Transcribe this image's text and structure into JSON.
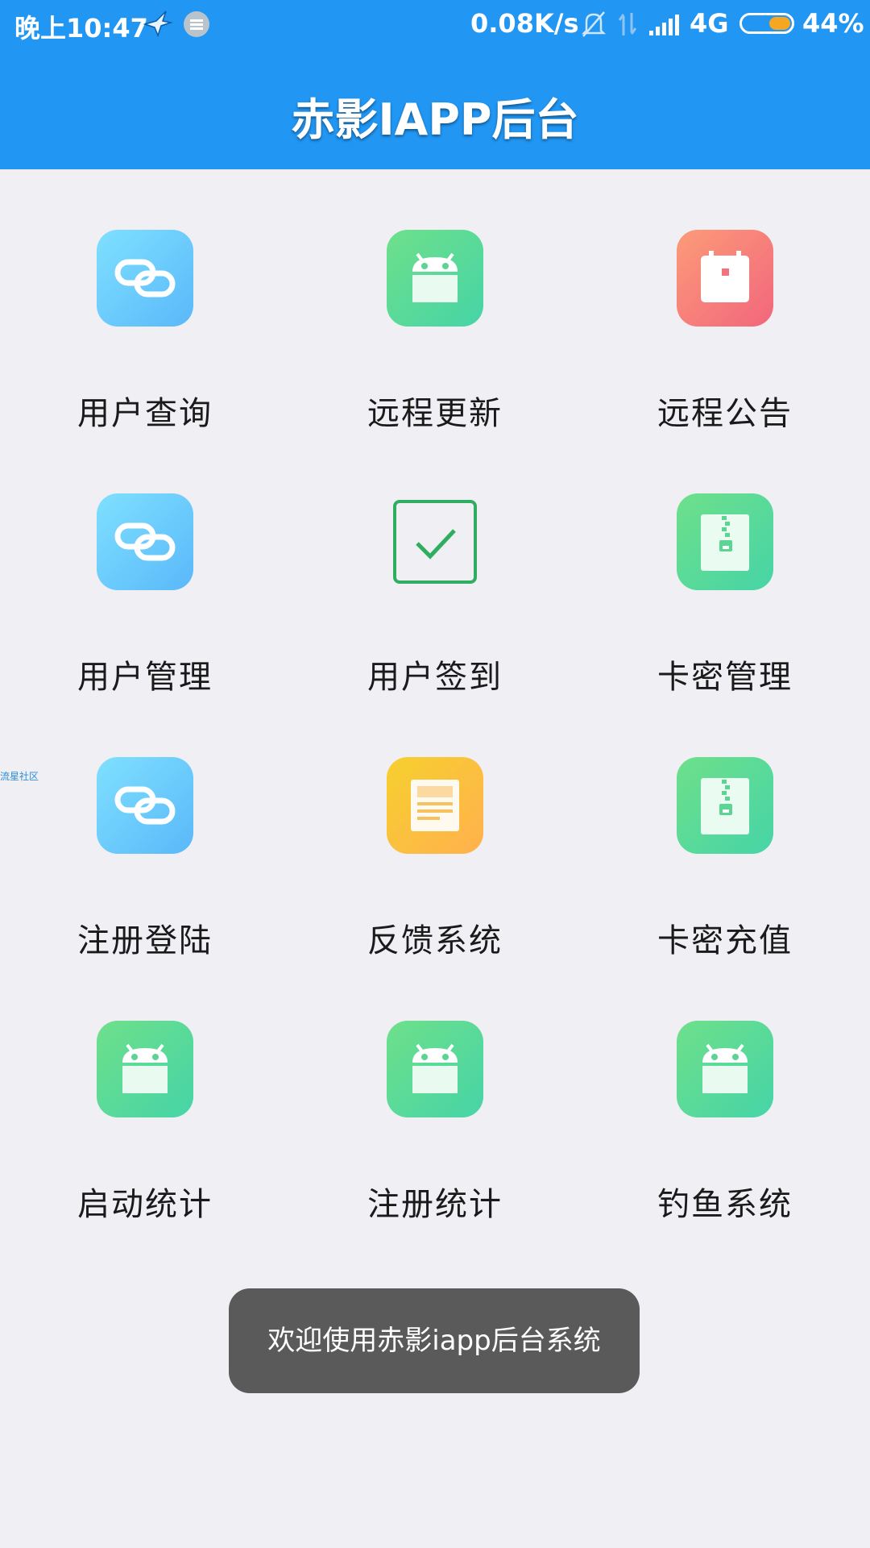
{
  "status_bar": {
    "time": "晚上10:47",
    "net_speed": "0.08K/s",
    "network": "4G",
    "battery_percent": "44%",
    "battery_level": 0.44,
    "icons": [
      "bird-icon",
      "message-icon",
      "bell-muted-icon",
      "data-arrows-icon",
      "signal-icon",
      "battery-icon"
    ]
  },
  "app_bar": {
    "title": "赤影IAPP后台"
  },
  "colors": {
    "primary": "#2196f3",
    "background": "#efeff4",
    "toast": "#5a5a5a"
  },
  "menu": {
    "items": [
      {
        "label": "用户查询",
        "icon": "link-icon"
      },
      {
        "label": "远程更新",
        "icon": "android-icon"
      },
      {
        "label": "远程公告",
        "icon": "calendar-icon"
      },
      {
        "label": "用户管理",
        "icon": "link-icon"
      },
      {
        "label": "用户签到",
        "icon": "checkbox-icon"
      },
      {
        "label": "卡密管理",
        "icon": "zip-file-icon"
      },
      {
        "label": "注册登陆",
        "icon": "link-icon"
      },
      {
        "label": "反馈系统",
        "icon": "document-icon"
      },
      {
        "label": "卡密充值",
        "icon": "zip-file-icon"
      },
      {
        "label": "启动统计",
        "icon": "android-icon"
      },
      {
        "label": "注册统计",
        "icon": "android-icon"
      },
      {
        "label": "钓鱼系统",
        "icon": "android-icon"
      }
    ]
  },
  "side_watermark": "流星社区",
  "toast": {
    "message": "欢迎使用赤影iapp后台系统"
  }
}
